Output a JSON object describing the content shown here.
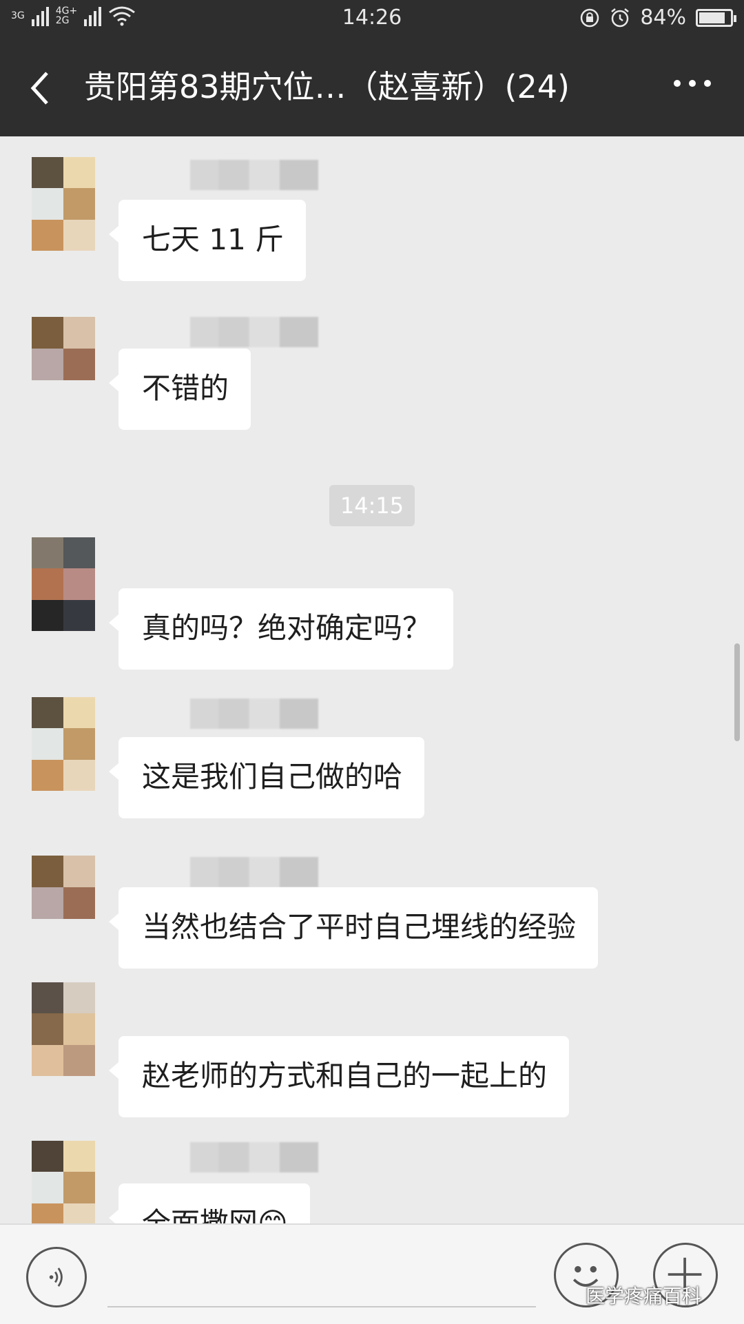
{
  "status_bar": {
    "network_1": "3G",
    "network_2_top": "4G+",
    "network_2_bottom": "2G",
    "time": "14:26",
    "battery_percent": "84%",
    "battery_level": 0.84,
    "icons": [
      "signal-icon",
      "wifi-icon",
      "orientation-lock-icon",
      "alarm-icon",
      "battery-icon"
    ]
  },
  "header": {
    "title": "贵阳第83期穴位…（赵喜新）(24)",
    "back_icon": "chevron-left-icon",
    "more_icon": "more-dots-icon"
  },
  "messages": [
    {
      "text": "七天 11 斤"
    },
    {
      "text": "不错的"
    },
    {
      "text": "真的吗？绝对确定吗？"
    },
    {
      "text": "这是我们自己做的哈"
    },
    {
      "text": "当然也结合了平时自己埋线的经验"
    },
    {
      "text": "赵老师的方式和自己的一起上的"
    },
    {
      "text": "全面撒网😊"
    }
  ],
  "timestamp": "14:15",
  "input_bar": {
    "voice_icon": "voice-icon",
    "emoji_icon": "emoji-icon",
    "plus_icon": "plus-icon"
  },
  "watermark": "医学疼痛百科",
  "colors": {
    "header_bg": "#2e2e2e",
    "chat_bg": "#ebebeb",
    "bubble_bg": "#ffffff"
  }
}
